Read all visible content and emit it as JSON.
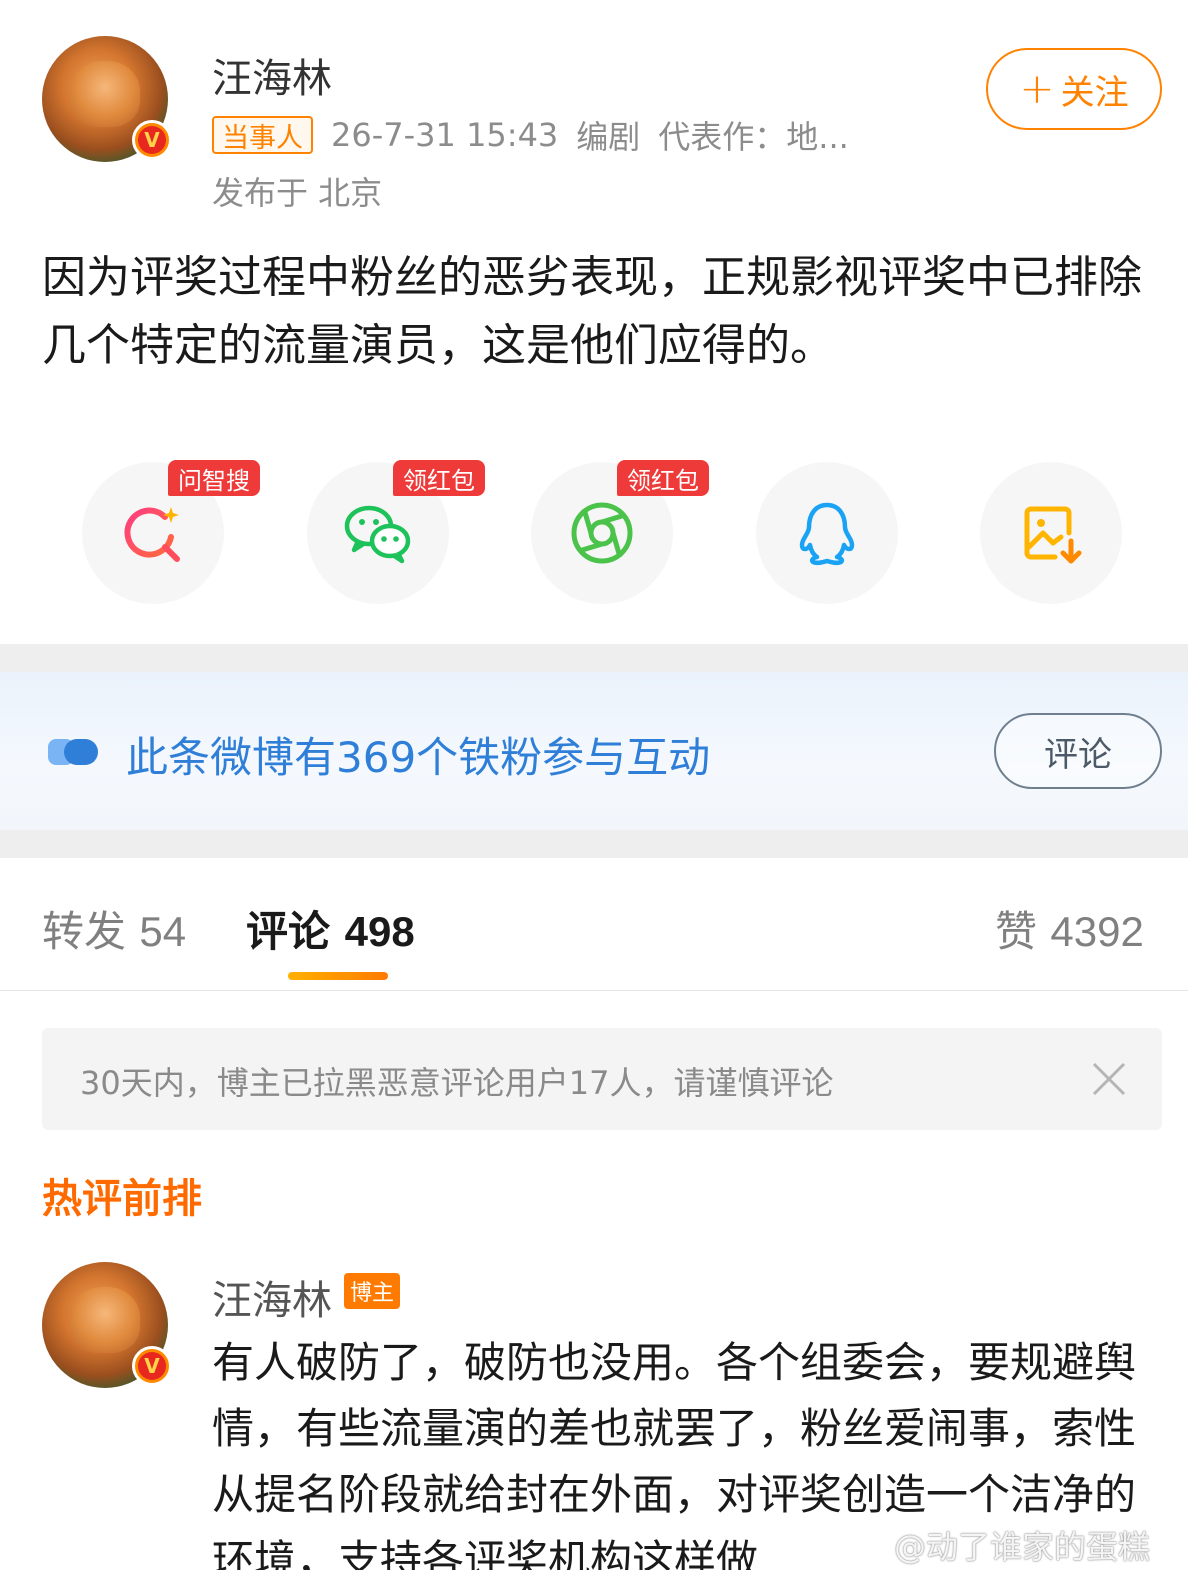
{
  "post": {
    "author": "汪海林",
    "tag": "当事人",
    "time": "26-7-31 15:43",
    "profession": "编剧",
    "representative_work": "代表作：地...",
    "location": "发布于 北京",
    "follow_label": "关注",
    "follow_plus": "+",
    "text": "因为评奖过程中粉丝的恶劣表现，正规影视评奖中已排除几个特定的流量演员，这是他们应得的。"
  },
  "share": {
    "items": [
      {
        "icon": "search-ai-icon",
        "badge": "问智搜"
      },
      {
        "icon": "wechat-icon",
        "badge": "领红包"
      },
      {
        "icon": "moments-icon",
        "badge": "领红包"
      },
      {
        "icon": "qq-icon",
        "badge": ""
      },
      {
        "icon": "save-image-icon",
        "badge": ""
      }
    ]
  },
  "fans_bar": {
    "text": "此条微博有369个铁粉参与互动",
    "button": "评论"
  },
  "tabs": {
    "repost": {
      "label": "转发",
      "count": "54"
    },
    "comment": {
      "label": "评论",
      "count": "498"
    },
    "like": {
      "label": "赞",
      "count": "4392"
    }
  },
  "notice": {
    "text": "30天内，博主已拉黑恶意评论用户17人，请谨慎评论"
  },
  "hot_comments": {
    "title": "热评前排",
    "items": [
      {
        "author": "汪海林",
        "badge": "博主",
        "text": "有人破防了，破防也没用。各个组委会，要规避舆情，有些流量演的差也就罢了，粉丝爱闹事，索性从提名阶段就给封在外面，对评奖创造一个洁净的环境，支持各评奖机构这样做"
      }
    ]
  },
  "watermark": "@动了谁家的蛋糕",
  "colors": {
    "accent": "#ff8200",
    "link_blue": "#2f7fd8",
    "badge_red": "#ef3a3a"
  }
}
